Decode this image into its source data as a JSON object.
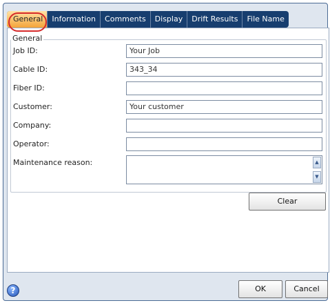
{
  "tabs": [
    {
      "label": "General",
      "active": true
    },
    {
      "label": "Information",
      "active": false
    },
    {
      "label": "Comments",
      "active": false
    },
    {
      "label": "Display",
      "active": false
    },
    {
      "label": "Drift Results",
      "active": false
    },
    {
      "label": "File Name",
      "active": false
    }
  ],
  "general": {
    "group_title": "General",
    "fields": [
      {
        "label": "Job ID:",
        "value": "Your Job"
      },
      {
        "label": "Cable ID:",
        "value": "343_34"
      },
      {
        "label": "Fiber ID:",
        "value": ""
      },
      {
        "label": "Customer:",
        "value": "Your customer"
      },
      {
        "label": "Company:",
        "value": ""
      },
      {
        "label": "Operator:",
        "value": ""
      }
    ],
    "maintenance": {
      "label": "Maintenance reason:",
      "value": ""
    },
    "clear_label": "Clear"
  },
  "footer": {
    "help_icon": "?",
    "ok_label": "OK",
    "cancel_label": "Cancel"
  },
  "colors": {
    "tab_bar": "#173e6f",
    "active_tab": "#f4a43a",
    "highlight": "#d62a2a"
  }
}
